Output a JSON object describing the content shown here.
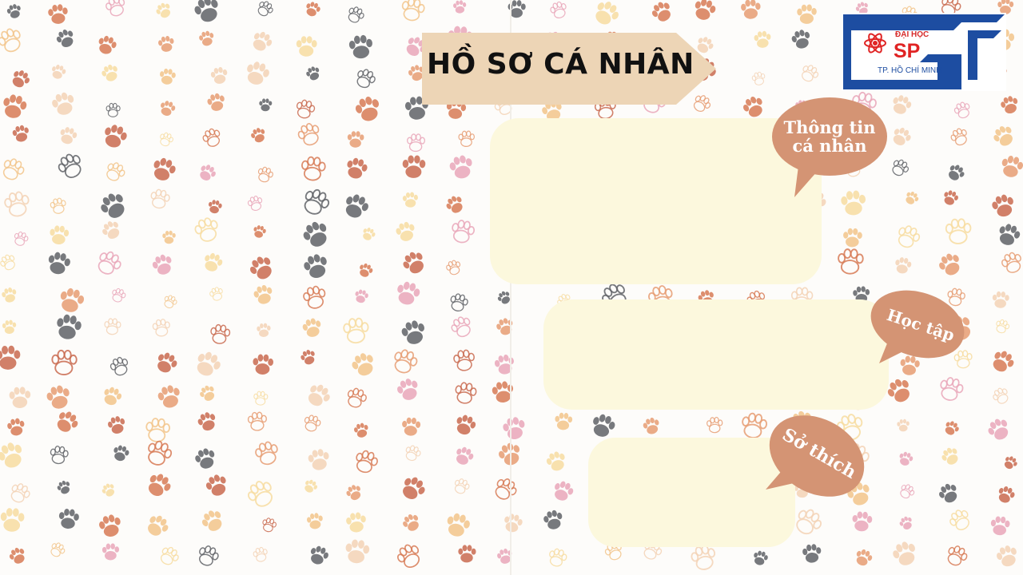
{
  "title": "HỒ SƠ CÁ NHÂN",
  "bubbles": {
    "personal": "Thông tin cá nhân",
    "study": "Học tập",
    "hobby": "Sở thích"
  },
  "logo": {
    "line1": "ĐẠI HỌC",
    "line2": "SP",
    "line3": "TP. HỒ CHÍ MINH"
  },
  "colors": {
    "banner": "#edd5b6",
    "card": "#fcf8dd",
    "bubble": "#d49474",
    "logo_blue": "#1d4da1",
    "logo_red": "#e02424"
  },
  "icons": {
    "background": "paw-print-icon",
    "logo": "atom-icon"
  }
}
